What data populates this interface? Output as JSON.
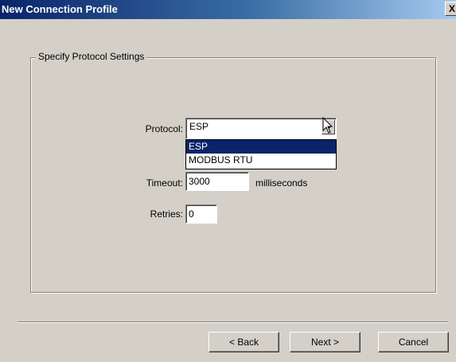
{
  "window": {
    "title": "New Connection Profile",
    "close_label": "X"
  },
  "group": {
    "title": "Specify Protocol Settings"
  },
  "protocol": {
    "label": "Protocol:",
    "value": "ESP",
    "options": [
      "ESP",
      "MODBUS RTU"
    ],
    "selected_index": 0
  },
  "timeout": {
    "label": "Timeout:",
    "value": "3000",
    "unit": "milliseconds"
  },
  "retries": {
    "label": "Retries:",
    "value": "0"
  },
  "buttons": {
    "back": "< Back",
    "next": "Next >",
    "cancel": "Cancel"
  },
  "colors": {
    "title_bar": "#0a246a",
    "selection": "#0a246a",
    "dialog_bg": "#d4d0c8"
  },
  "icons": {
    "cursor": "mouse-pointer-icon",
    "dropdown": "chevron-down-icon"
  }
}
